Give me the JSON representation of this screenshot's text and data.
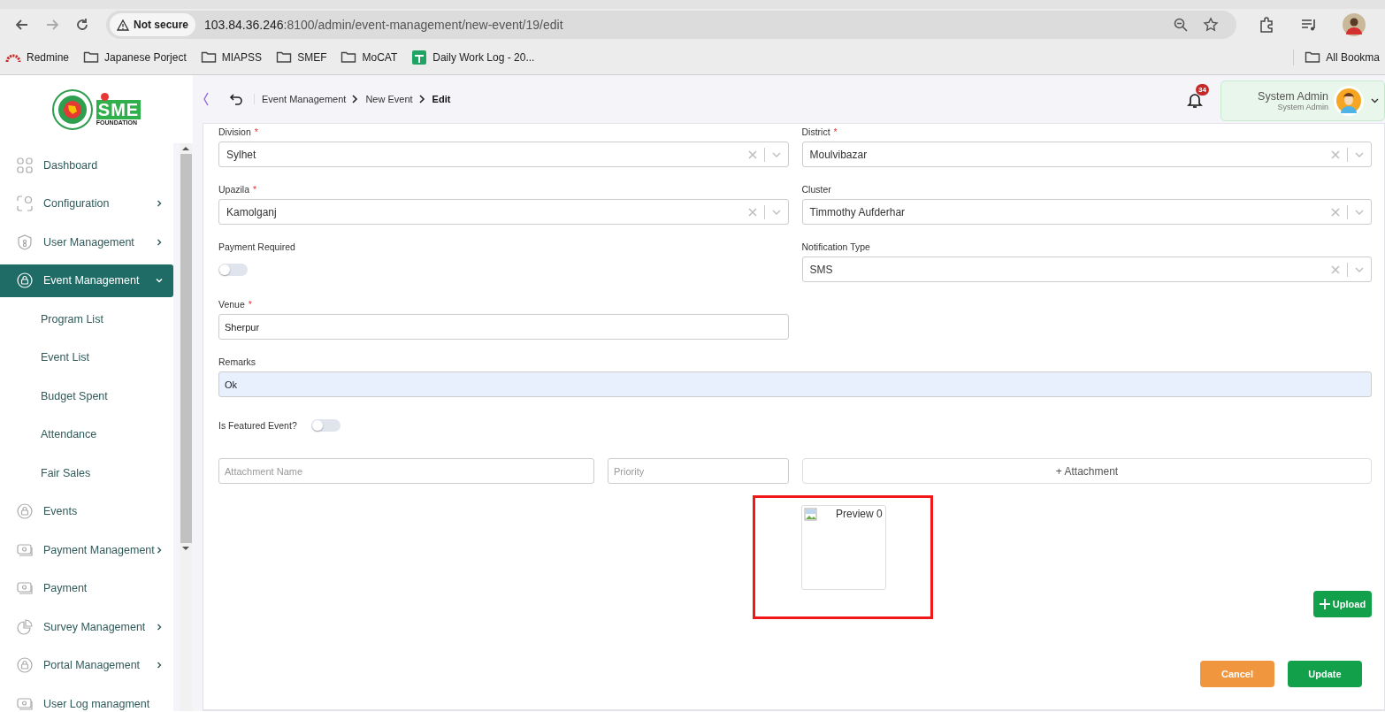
{
  "browser": {
    "security": "Not secure",
    "url_host": "103.84.36.246",
    "url_rest": ":8100/admin/event-management/new-event/19/edit",
    "bookmarks": [
      {
        "kind": "redmine",
        "label": "Redmine"
      },
      {
        "kind": "folder",
        "label": "Japanese Porject"
      },
      {
        "kind": "folder",
        "label": "MIAPSS"
      },
      {
        "kind": "folder",
        "label": "SMEF"
      },
      {
        "kind": "folder",
        "label": "MoCAT"
      },
      {
        "kind": "sheet",
        "label": "Daily Work Log - 20..."
      }
    ],
    "all_bookmarks": "All Bookma"
  },
  "logo": {
    "mark": "SME",
    "subtitle": "FOUNDATION"
  },
  "header": {
    "breadcrumb": [
      {
        "label": "Event Management",
        "current": false
      },
      {
        "label": "New Event",
        "current": false
      },
      {
        "label": "Edit",
        "current": true
      }
    ],
    "notifications": "34",
    "user_name": "System Admin",
    "user_role": "System Admin"
  },
  "sidebar": {
    "items": [
      {
        "label": "Dashboard",
        "has_children": false,
        "selected": false
      },
      {
        "label": "Configuration",
        "has_children": true,
        "expanded": false,
        "selected": false
      },
      {
        "label": "User Management",
        "has_children": true,
        "expanded": false,
        "selected": false
      },
      {
        "label": "Event Management",
        "has_children": true,
        "expanded": true,
        "selected": true,
        "children": [
          {
            "label": "Program List"
          },
          {
            "label": "Event List"
          },
          {
            "label": "Budget Spent"
          },
          {
            "label": "Attendance"
          },
          {
            "label": "Fair Sales"
          }
        ]
      },
      {
        "label": "Events",
        "has_children": false,
        "selected": false
      },
      {
        "label": "Payment Management",
        "has_children": true,
        "expanded": false,
        "selected": false
      },
      {
        "label": "Payment",
        "has_children": false,
        "selected": false
      },
      {
        "label": "Survey Management",
        "has_children": true,
        "expanded": false,
        "selected": false
      },
      {
        "label": "Portal Management",
        "has_children": true,
        "expanded": false,
        "selected": false
      },
      {
        "label": "User Log managment",
        "has_children": false,
        "selected": false
      }
    ]
  },
  "form": {
    "rows": [
      [
        {
          "kind": "select",
          "label": "Division",
          "required_mark": "*",
          "value": "Sylhet"
        },
        {
          "kind": "select",
          "label": "District",
          "required_mark": "*",
          "value": "Moulvibazar"
        }
      ],
      [
        {
          "kind": "select",
          "label": "Upazila",
          "required_mark": "*",
          "value": "Kamolganj"
        },
        {
          "kind": "select",
          "label": "Cluster",
          "value": "Timmothy Aufderhar"
        }
      ],
      [
        {
          "kind": "toggle",
          "label": "Payment Required",
          "on": false
        },
        {
          "kind": "select",
          "label": "Notification Type",
          "value": "SMS"
        }
      ],
      [
        {
          "kind": "text",
          "label": "Venue",
          "required_mark": "*",
          "value": "Sherpur"
        }
      ]
    ],
    "remarks": {
      "label": "Remarks",
      "value": "Ok"
    },
    "featured": {
      "label": "Is Featured Event?",
      "on": false
    },
    "attachment": {
      "name_placeholder": "Attachment Name",
      "priority_placeholder": "Priority",
      "add_label": "+ Attachment"
    },
    "preview": {
      "alt": "Preview 0",
      "highlighted": true
    },
    "buttons": [
      {
        "kind": "upload",
        "label": "Upload"
      },
      {
        "kind": "cancel",
        "label": "Cancel"
      },
      {
        "kind": "update",
        "label": "Update"
      }
    ]
  }
}
